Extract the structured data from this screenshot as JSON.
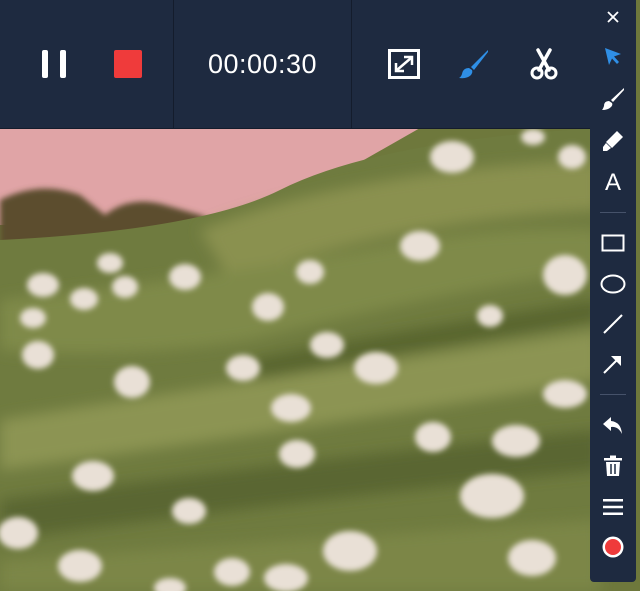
{
  "recorder": {
    "elapsed_time": "00:00:30",
    "accent_color": "#2f8fe6",
    "record_color": "#ef3b3b",
    "controls": [
      "pause-icon",
      "stop-icon"
    ],
    "tools": [
      "fullscreen-icon",
      "brush-icon",
      "scissors-icon"
    ],
    "active_tool": "brush-icon"
  },
  "sidebar": {
    "text_tool_label": "A",
    "tools": [
      "close-icon",
      "select-arrow-icon",
      "brush-icon",
      "marker-icon",
      "text-icon",
      "rectangle-icon",
      "ellipse-icon",
      "line-icon",
      "arrow-icon",
      "undo-icon",
      "trash-icon",
      "menu-icon",
      "record-icon"
    ],
    "active_tool": "select-arrow-icon"
  }
}
